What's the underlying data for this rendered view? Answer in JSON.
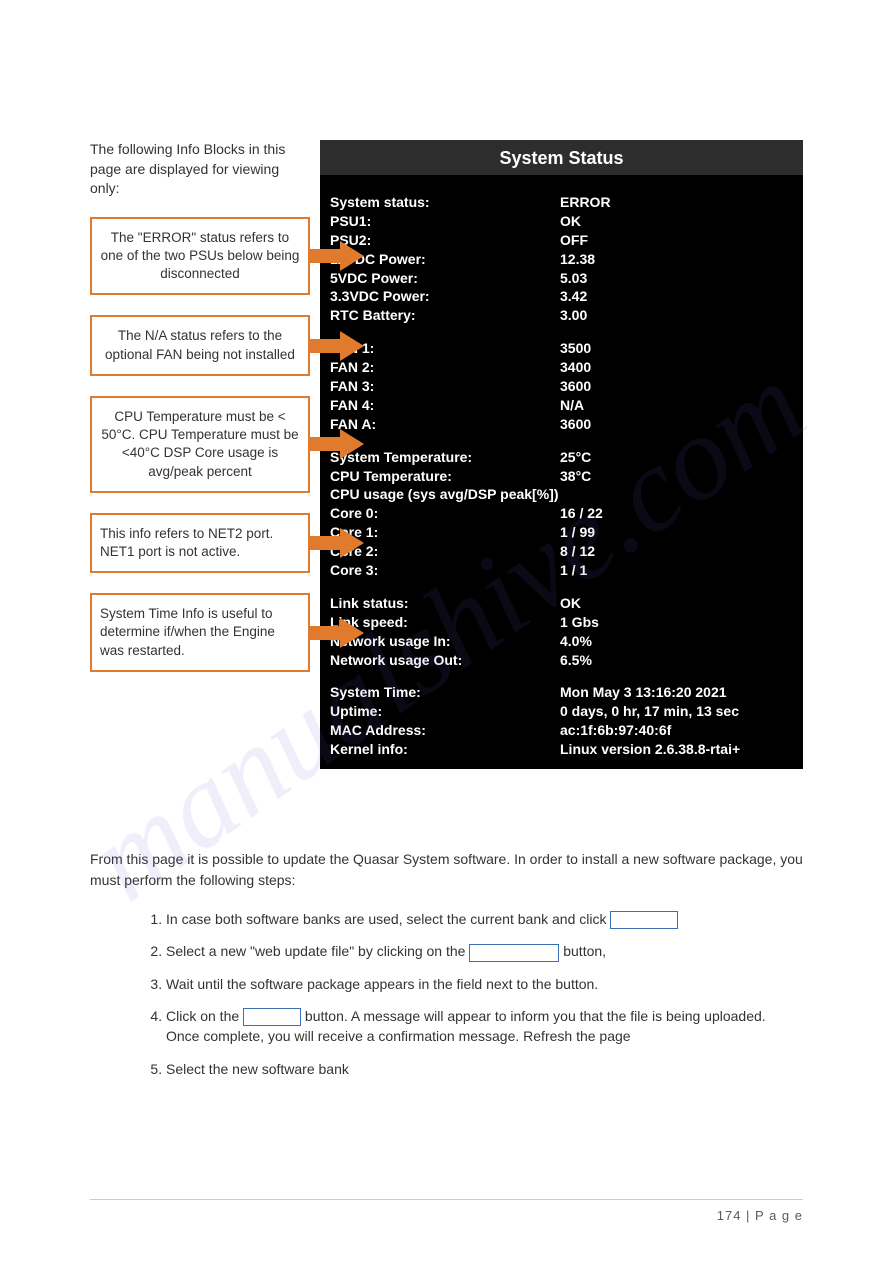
{
  "intro": "The following Info Blocks in this page are displayed for viewing only:",
  "callouts": {
    "c1": "The \"ERROR\" status refers to one of the two PSUs below being disconnected",
    "c2": "The N/A status refers to the optional FAN being not installed",
    "c3": "CPU Temperature must be < 50°C. CPU Temperature must be <40°C DSP Core usage is avg/peak percent",
    "c4": "This info refers to NET2 port. NET1 port is not active.",
    "c5": "System Time Info is useful to determine if/when the Engine was restarted."
  },
  "panel": {
    "title": "System Status",
    "block1": [
      {
        "label": "System status:",
        "value": "ERROR"
      },
      {
        "label": "PSU1:",
        "value": "OK"
      },
      {
        "label": "PSU2:",
        "value": "OFF"
      },
      {
        "label": "12VDC Power:",
        "value": "12.38"
      },
      {
        "label": "5VDC Power:",
        "value": "5.03"
      },
      {
        "label": "3.3VDC Power:",
        "value": "3.42"
      },
      {
        "label": "RTC Battery:",
        "value": "3.00"
      }
    ],
    "block2": [
      {
        "label": "FAN 1:",
        "value": "3500"
      },
      {
        "label": "FAN 2:",
        "value": "3400"
      },
      {
        "label": "FAN 3:",
        "value": "3600"
      },
      {
        "label": "FAN 4:",
        "value": "N/A"
      },
      {
        "label": "FAN A:",
        "value": "3600"
      }
    ],
    "block3_header": [
      {
        "label": "System Temperature:",
        "value": "25°C"
      },
      {
        "label": "CPU Temperature:",
        "value": "38°C"
      }
    ],
    "cpu_usage_heading": "CPU usage (sys avg/DSP peak[%])",
    "block3_cores": [
      {
        "label": "Core 0:",
        "value": "16 / 22"
      },
      {
        "label": "Core 1:",
        "value": "1 / 99"
      },
      {
        "label": "Core 2:",
        "value": "8 / 12"
      },
      {
        "label": "Core 3:",
        "value": "1 / 1"
      }
    ],
    "block4": [
      {
        "label": "Link status:",
        "value": "OK"
      },
      {
        "label": "Link speed:",
        "value": "1 Gbs"
      },
      {
        "label": "Network usage In:",
        "value": "4.0%"
      },
      {
        "label": "Network usage Out:",
        "value": "6.5%"
      }
    ],
    "block5": [
      {
        "label": "System Time:",
        "value": "Mon May 3 13:16:20 2021"
      },
      {
        "label": "Uptime:",
        "value": "0 days, 0 hr, 17 min, 13 sec"
      },
      {
        "label": "MAC Address:",
        "value": "ac:1f:6b:97:40:6f"
      },
      {
        "label": "Kernel info:",
        "value": "Linux version 2.6.38.8-rtai+"
      }
    ]
  },
  "bottom_intro": "From this page it is possible to update the Quasar System software. In order to install a new software package, you must perform the following steps:",
  "steps": {
    "s1a": "In case both software banks are used, select the current bank and click ",
    "s2a": "Select a new \"web update file\" by clicking on the ",
    "s2b": " button,",
    "s3": "Wait until the software package appears in the field next to the button.",
    "s4a": "Click on the ",
    "s4b": " button. A message will appear to inform you that the file is being uploaded. Once complete, you will receive a confirmation message. Refresh the page",
    "s5": "Select the new software bank"
  },
  "watermark": "manualshive.com",
  "footer": "174 | P a g e"
}
